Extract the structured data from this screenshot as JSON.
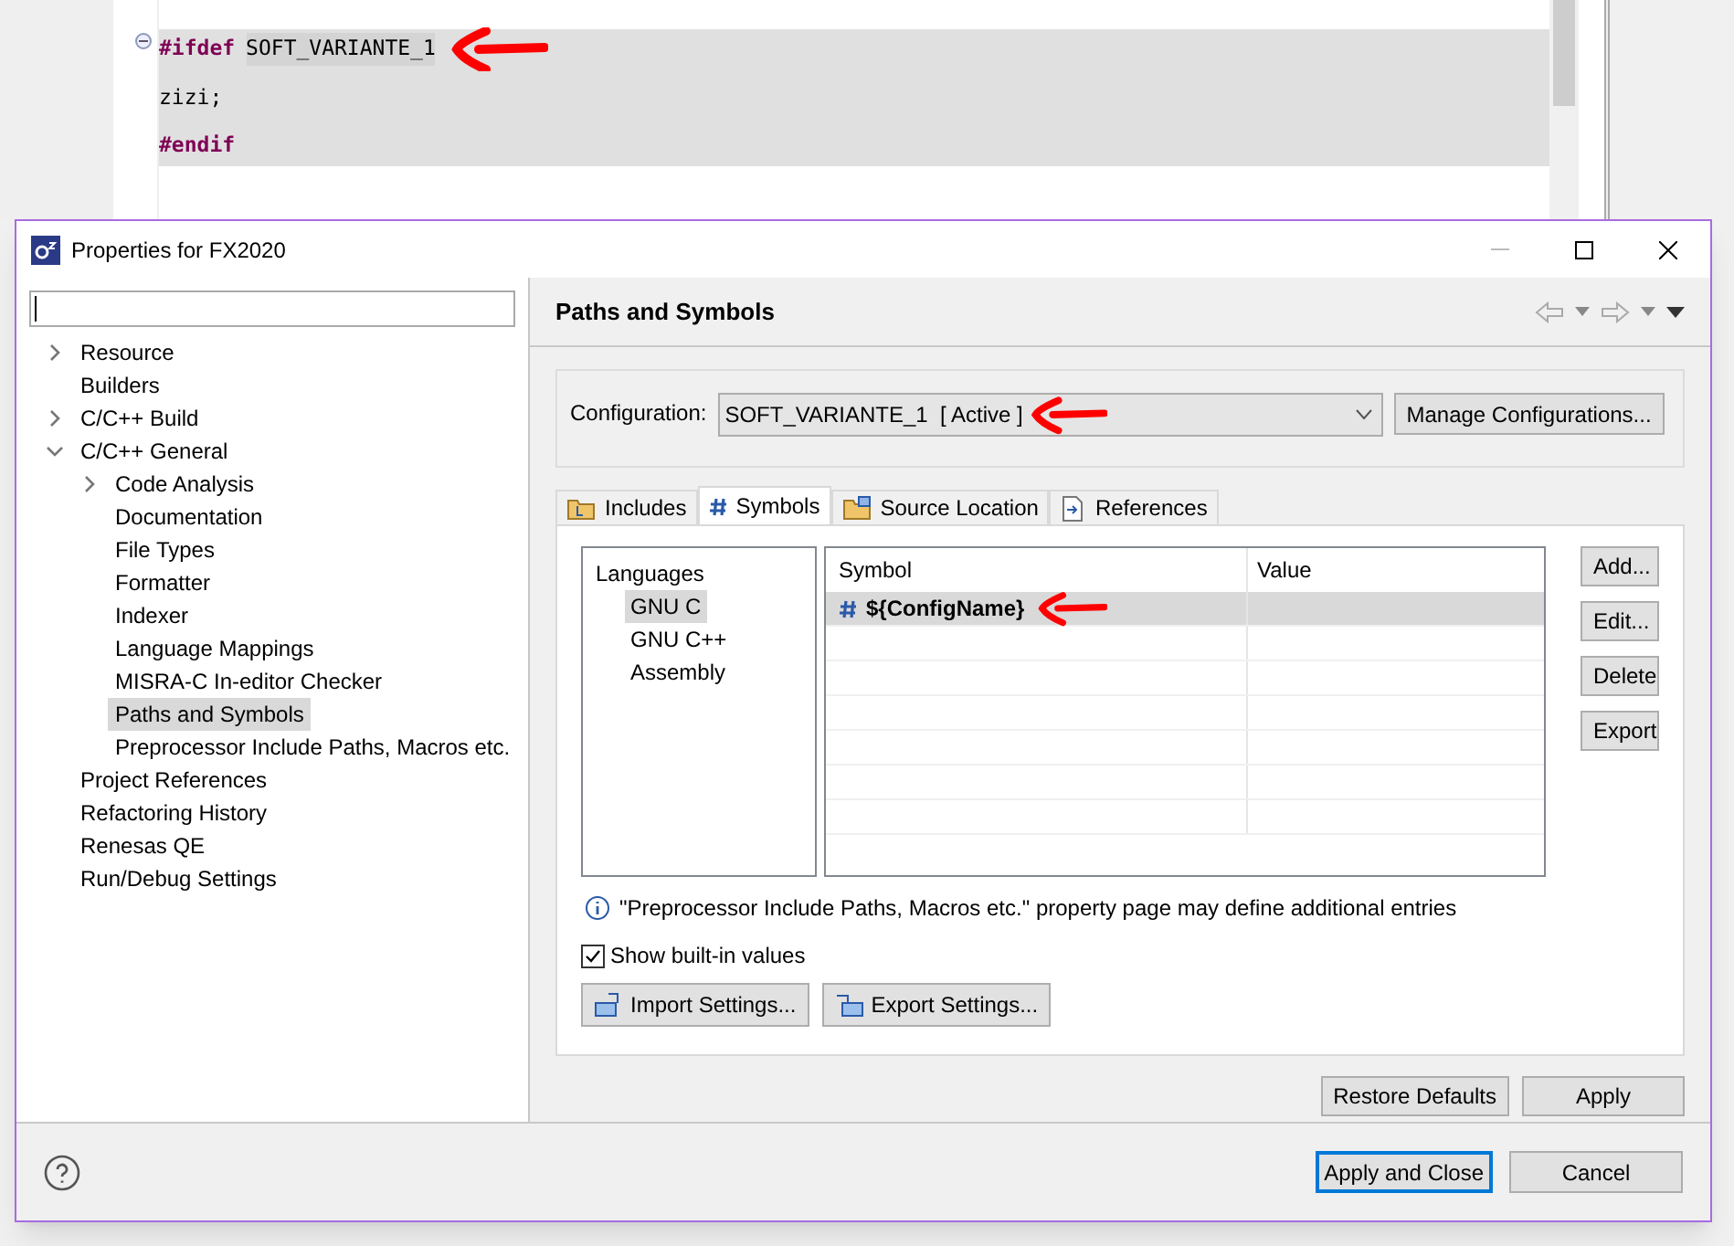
{
  "editor": {
    "lines": [
      {
        "kind": "directive",
        "keyword": "#ifdef",
        "argument": "SOFT_VARIANTE_1"
      },
      {
        "kind": "code",
        "text": "zizi;"
      },
      {
        "kind": "directive",
        "keyword": "#endif"
      }
    ]
  },
  "dialog": {
    "title": "Properties for FX2020",
    "tree": [
      {
        "label": "Resource",
        "expanded": false,
        "selected": false
      },
      {
        "label": "Builders",
        "selected": false
      },
      {
        "label": "C/C++ Build",
        "expanded": false,
        "selected": false
      },
      {
        "label": "C/C++ General",
        "expanded": true,
        "selected": false,
        "children": [
          {
            "label": "Code Analysis",
            "expanded": false,
            "selected": false
          },
          {
            "label": "Documentation",
            "selected": false
          },
          {
            "label": "File Types",
            "selected": false
          },
          {
            "label": "Formatter",
            "selected": false
          },
          {
            "label": "Indexer",
            "selected": false
          },
          {
            "label": "Language Mappings",
            "selected": false
          },
          {
            "label": "MISRA-C In-editor Checker",
            "selected": false
          },
          {
            "label": "Paths and Symbols",
            "selected": true
          },
          {
            "label": "Preprocessor Include Paths, Macros etc.",
            "selected": false
          }
        ]
      },
      {
        "label": "Project References",
        "selected": false
      },
      {
        "label": "Refactoring History",
        "selected": false
      },
      {
        "label": "Renesas QE",
        "selected": false
      },
      {
        "label": "Run/Debug Settings",
        "selected": false
      }
    ],
    "page": {
      "title": "Paths and Symbols",
      "configuration": {
        "label": "Configuration:",
        "value": "SOFT_VARIANTE_1  [ Active ]",
        "button": "Manage Configurations..."
      },
      "tabs": [
        {
          "label": "Includes",
          "kind": "includes",
          "selected": false
        },
        {
          "label": "Symbols",
          "kind": "symbols",
          "selected": true
        },
        {
          "label": "Source Location",
          "kind": "source",
          "selected": false
        },
        {
          "label": "References",
          "kind": "references",
          "selected": false
        }
      ],
      "languages": {
        "heading": "Languages",
        "items": [
          {
            "label": "GNU C",
            "selected": true
          },
          {
            "label": "GNU C++",
            "selected": false
          },
          {
            "label": "Assembly",
            "selected": false
          }
        ]
      },
      "table": {
        "columns": [
          "Symbol",
          "Value"
        ],
        "rows": [
          {
            "symbol": "${ConfigName}",
            "selected": true
          }
        ]
      },
      "side_buttons": [
        "Add...",
        "Edit...",
        "Delete",
        "Export"
      ],
      "note": "\"Preprocessor Include Paths, Macros etc.\" property page may define additional entries",
      "show_builtin": {
        "label": "Show built-in values",
        "checked": true
      },
      "import_button": "Import Settings...",
      "export_button": "Export Settings...",
      "restore_button": "Restore Defaults",
      "apply_button": "Apply"
    },
    "footer": {
      "apply_close_button": "Apply and Close",
      "cancel_button": "Cancel"
    }
  }
}
